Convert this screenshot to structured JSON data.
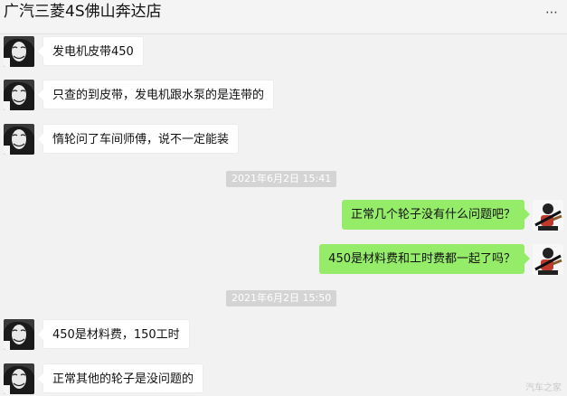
{
  "header": {
    "title": "广汽三菱4S佛山奔达店",
    "more_icon": "more-icon"
  },
  "messages": [
    {
      "direction": "in",
      "text": "发电机皮带450",
      "avatar": "contact-avatar"
    },
    {
      "direction": "in",
      "text": "只查的到皮带，发电机跟水泵的是连带的",
      "avatar": "contact-avatar"
    },
    {
      "direction": "in",
      "text": "惰轮问了车间师傅，说不一定能装",
      "avatar": "contact-avatar"
    },
    {
      "type": "timestamp",
      "text": "2021年6月2日 15:41"
    },
    {
      "direction": "out",
      "text": "正常几个轮子没有什么问题吧？",
      "avatar": "self-avatar"
    },
    {
      "direction": "out",
      "text": "450是材料费和工时费都一起了吗？",
      "avatar": "self-avatar"
    },
    {
      "type": "timestamp",
      "text": "2021年6月2日 15:50"
    },
    {
      "direction": "in",
      "text": "450是材料费，150工时",
      "avatar": "contact-avatar"
    },
    {
      "direction": "in",
      "text": "正常其他的轮子是没问题的",
      "avatar": "contact-avatar"
    }
  ],
  "watermark": "汽车之家",
  "colors": {
    "background": "#f2f2f2",
    "incoming_bubble": "#ffffff",
    "outgoing_bubble": "#95ec69",
    "timestamp_bg": "#d4d4d4"
  }
}
